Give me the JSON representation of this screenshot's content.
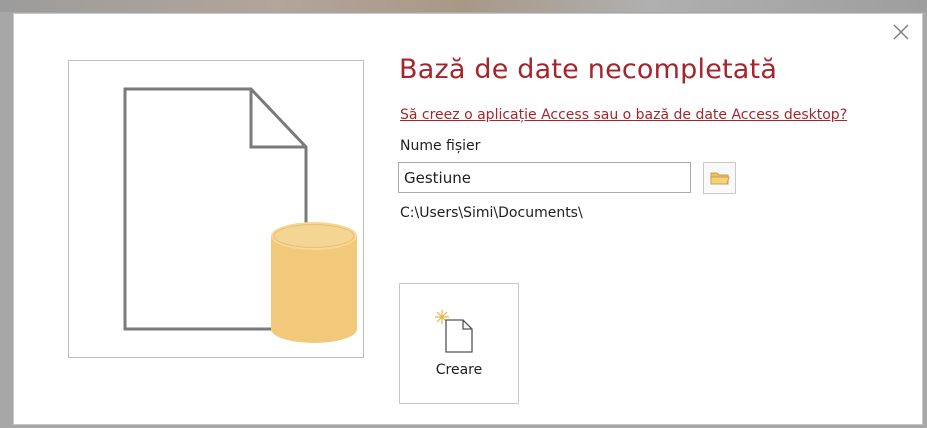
{
  "dialog": {
    "title": "Bază de date necompletată",
    "link_text": "Să creez o aplicație Access sau o bază de date Access desktop?",
    "filename_label": "Nume fișier",
    "filename_value": "Gestiune",
    "save_path": "C:\\Users\\Simi\\Documents\\",
    "create_label": "Creare"
  },
  "icons": {
    "close": "close-icon",
    "browse": "folder-icon",
    "preview": "blank-database-illustration",
    "create": "new-document-icon"
  },
  "colors": {
    "accent": "#a4262c",
    "database": "#f2c97a",
    "document_outline": "#7a7a7a"
  }
}
